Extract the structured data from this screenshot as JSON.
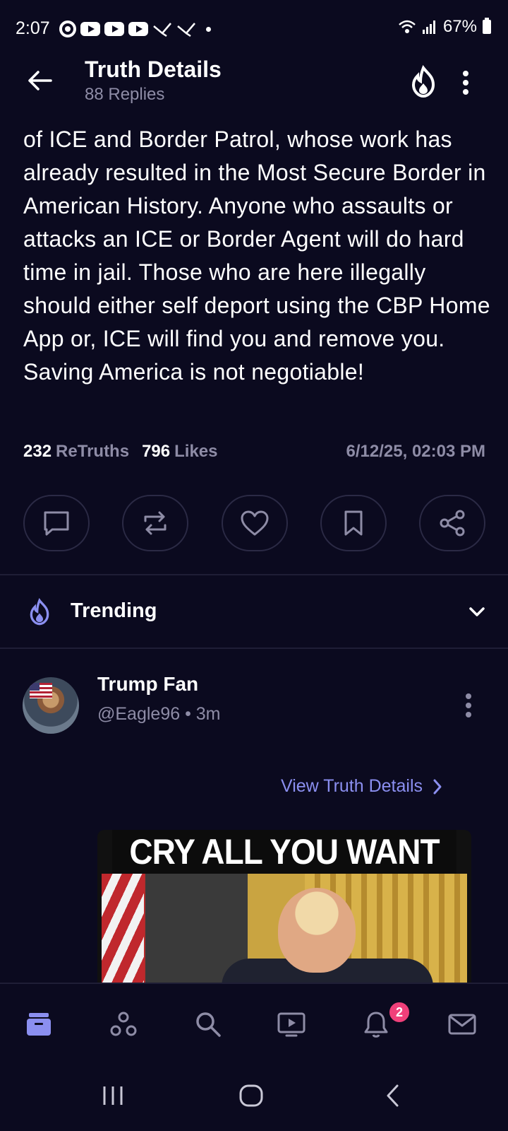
{
  "status_bar": {
    "time": "2:07",
    "battery": "67%"
  },
  "header": {
    "title": "Truth Details",
    "subtitle": "88 Replies"
  },
  "post": {
    "text": "of ICE and Border Patrol, whose work has already resulted in the Most Secure Border in American History. Anyone who assaults or attacks an ICE or Border Agent will do hard time in jail. Those who are here illegally should either self deport using the CBP Home App or, ICE will find you and remove you. Saving America is not negotiable!",
    "retruths_count": "232",
    "retruths_label": "ReTruths",
    "likes_count": "796",
    "likes_label": "Likes",
    "timestamp": "6/12/25, 02:03 PM"
  },
  "actions": {
    "icons": [
      "comment-icon",
      "retruth-icon",
      "like-icon",
      "bookmark-icon",
      "share-icon"
    ]
  },
  "trending": {
    "label": "Trending"
  },
  "card": {
    "name": "Trump Fan",
    "handle": "@Eagle96 • 3m",
    "view_details": "View Truth Details",
    "meme_caption": "CRY ALL YOU WANT"
  },
  "bottom_nav": {
    "items": [
      "home-icon",
      "groups-icon",
      "search-icon",
      "video-icon",
      "notifications-icon",
      "messages-icon"
    ],
    "notification_count": "2"
  },
  "colors": {
    "background": "#0b0a1f",
    "accent": "#8b8ff0",
    "muted": "#8e8ca6",
    "badge": "#f0407a"
  }
}
